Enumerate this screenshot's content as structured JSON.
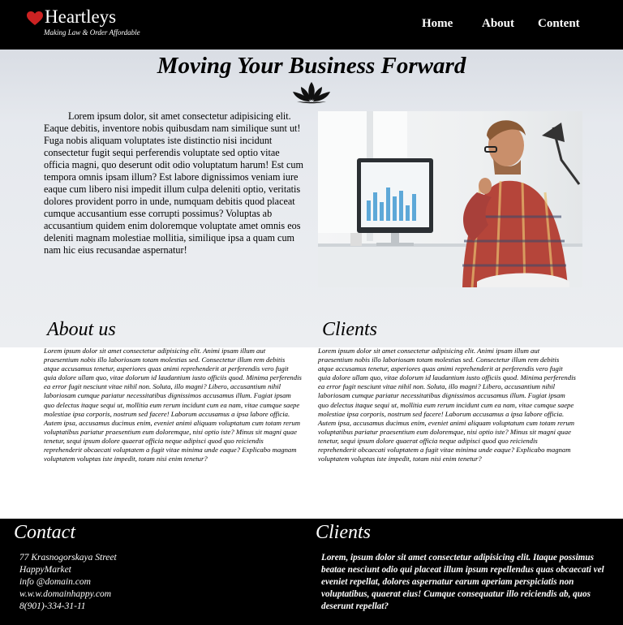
{
  "header": {
    "brand": "Heartleys",
    "tagline": "Making Law & Order Affordable",
    "nav": [
      "Home",
      "About",
      "Content"
    ]
  },
  "hero": {
    "title": "Moving Your Business Forward",
    "text": "Lorem ipsum dolor, sit amet consectetur adipisicing elit. Eaque debitis, inventore nobis quibusdam nam similique sunt ut! Fuga nobis aliquam voluptates iste distinctio nisi incidunt consectetur fugit sequi perferendis voluptate sed optio vitae officia magni, quo deserunt odit odio voluptatum harum! Est cum tempora omnis ipsam illum? Est labore dignissimos veniam iure eaque cum libero nisi impedit illum culpa deleniti optio, veritatis dolores provident porro in unde, numquam debitis quod placeat cumque accusantium esse corrupti possimus? Voluptas ab accusantium quidem enim doloremque voluptate amet omnis eos deleniti magnam molestiae mollitia, similique ipsa a quam cum nam hic eius recusandae aspernatur!"
  },
  "about": {
    "title": "About us",
    "text": "Lorem ipsum dolor sit amet consectetur adipisicing elit. Animi ipsam illum aut praesentium nobis illo laboriosam totam molestias sed. Consectetur illum rem debitis atque accusamus tenetur, asperiores quas animi reprehenderit at perferendis vero fugit quia dolore ullam quo, vitae dolorum id laudantium iusto officiis quod. Minima perferendis ea error fugit nesciunt vitae nihil non. Soluta, illo magni? Libero, accusantium nihil laboriosam cumque pariatur necessitatibus dignissimos accusamus illum. Fugiat ipsam quo delectus itaque sequi ut, mollitia eum rerum incidunt cum ea nam, vitae cumque saepe molestiae ipsa corporis, nostrum sed facere! Laborum accusamus a ipsa labore officia. Autem ipsa, accusamus ducimus enim, eveniet animi aliquam voluptatum cum totam rerum voluptatibus pariatur praesentium eum doloremque, nisi optio iste? Minus sit magni quae tenetur, sequi ipsum dolore quaerat officia neque adipisci quod quo reiciendis reprehenderit obcaecati voluptatem a fugit vitae minima unde eaque? Explicabo magnam voluptatem voluptas iste impedit, totam nisi enim tenetur?"
  },
  "clients": {
    "title": "Clients",
    "text": "Lorem ipsum dolor sit amet consectetur adipisicing elit. Animi ipsam illum aut praesentium nobis illo laboriosam totam molestias sed. Consectetur illum rem debitis atque accusamus tenetur, asperiores quas animi reprehenderit at perferendis vero fugit quia dolore ullam quo, vitae dolorum id laudantium iusto officiis quod. Minima perferendis ea error fugit nesciunt vitae nihil non. Soluta, illo magni? Libero, accusantium nihil laboriosam cumque pariatur necessitatibus dignissimos accusamus illum. Fugiat ipsam quo delectus itaque sequi ut, mollitia eum rerum incidunt cum ea nam, vitae cumque saepe molestiae ipsa corporis, nostrum sed facere! Laborum accusamus a ipsa labore officia. Autem ipsa, accusamus ducimus enim, eveniet animi aliquam voluptatum cum totam rerum voluptatibus pariatur praesentium eum doloremque, nisi optio iste? Minus sit magni quae tenetur, sequi ipsum dolore quaerat officia neque adipisci quod quo reiciendis reprehenderit obcaecati voluptatem a fugit vitae minima unde eaque? Explicabo magnam voluptatem voluptas iste impedit, totam nisi enim tenetur?"
  },
  "footer": {
    "contact_title": "Contact",
    "address": [
      "77 Krasnogorskaya Street",
      "HappyMarket",
      "info @domain.com",
      "w.w.w.domainhappy.com",
      "8(901)-334-31-11"
    ],
    "clients_title": "Clients",
    "clients_text": "Lorem, ipsum dolor sit amet consectetur adipisicing elit. Itaque possimus beatae nesciunt odio qui placeat illum ipsum repellendus quas obcaecati vel eveniet repellat, dolores aspernatur earum aperiam perspiciatis non voluptatibus, quaerat eius! Cumque consequatur illo reiciendis ab, quos deserunt repellat?"
  },
  "colors": {
    "header_bg": "#000000",
    "heart": "#cc2222",
    "hero_bg": "#e6e9ee"
  }
}
